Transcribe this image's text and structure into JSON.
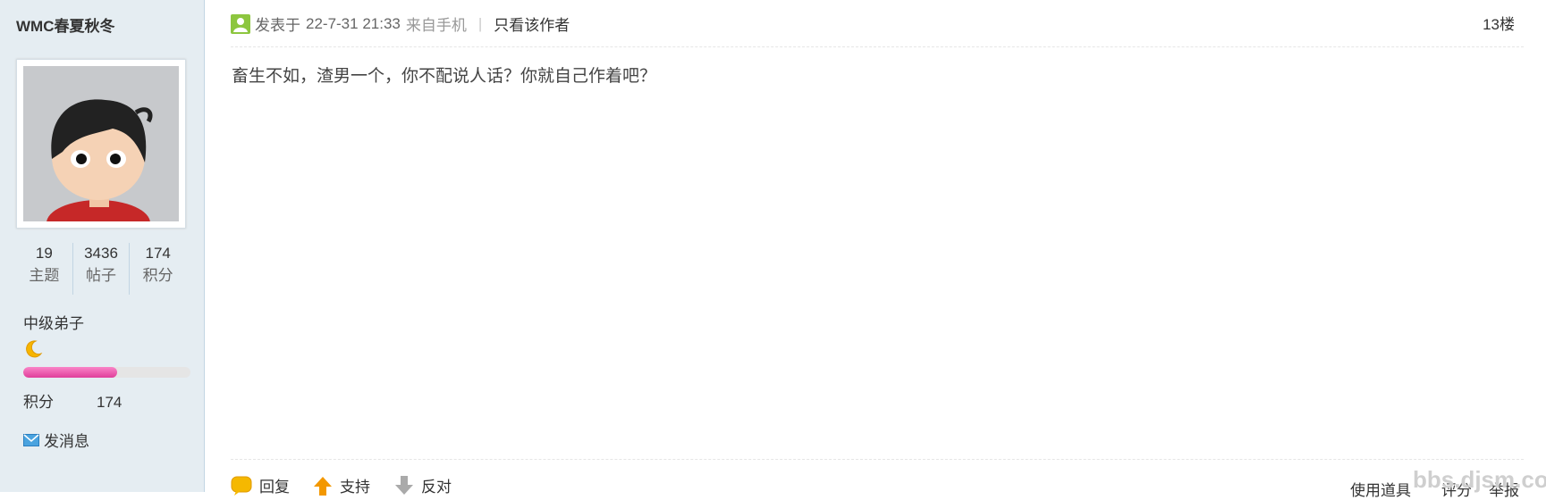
{
  "user": {
    "name": "WMC春夏秋冬",
    "stats": [
      {
        "value": "19",
        "label": "主题"
      },
      {
        "value": "3436",
        "label": "帖子"
      },
      {
        "value": "174",
        "label": "积分"
      }
    ],
    "rank": "中级弟子",
    "progress_fraction": 0.56,
    "points_label": "积分",
    "points_value": "174",
    "message_label": "发消息"
  },
  "post": {
    "posted_prefix": "发表于",
    "datetime": "22-7-31 21:33",
    "source": "来自手机",
    "separator": "|",
    "only_author": "只看该作者",
    "floor": "13楼",
    "content": "畜生不如，渣男一个，你不配说人话？你就自己作着吧？"
  },
  "footer": {
    "reply": "回复",
    "support": "支持",
    "oppose": "反对",
    "use_tool": "使用道具",
    "rate": "评分",
    "report": "举报"
  },
  "watermark": "bbs.djsm.com",
  "colors": {
    "sidebar_bg": "#e5edf2",
    "progress_fill": "#e03e9a",
    "author_icon": "#8dc63f",
    "support_arrow": "#f39800",
    "oppose_arrow": "#aaaaaa"
  }
}
